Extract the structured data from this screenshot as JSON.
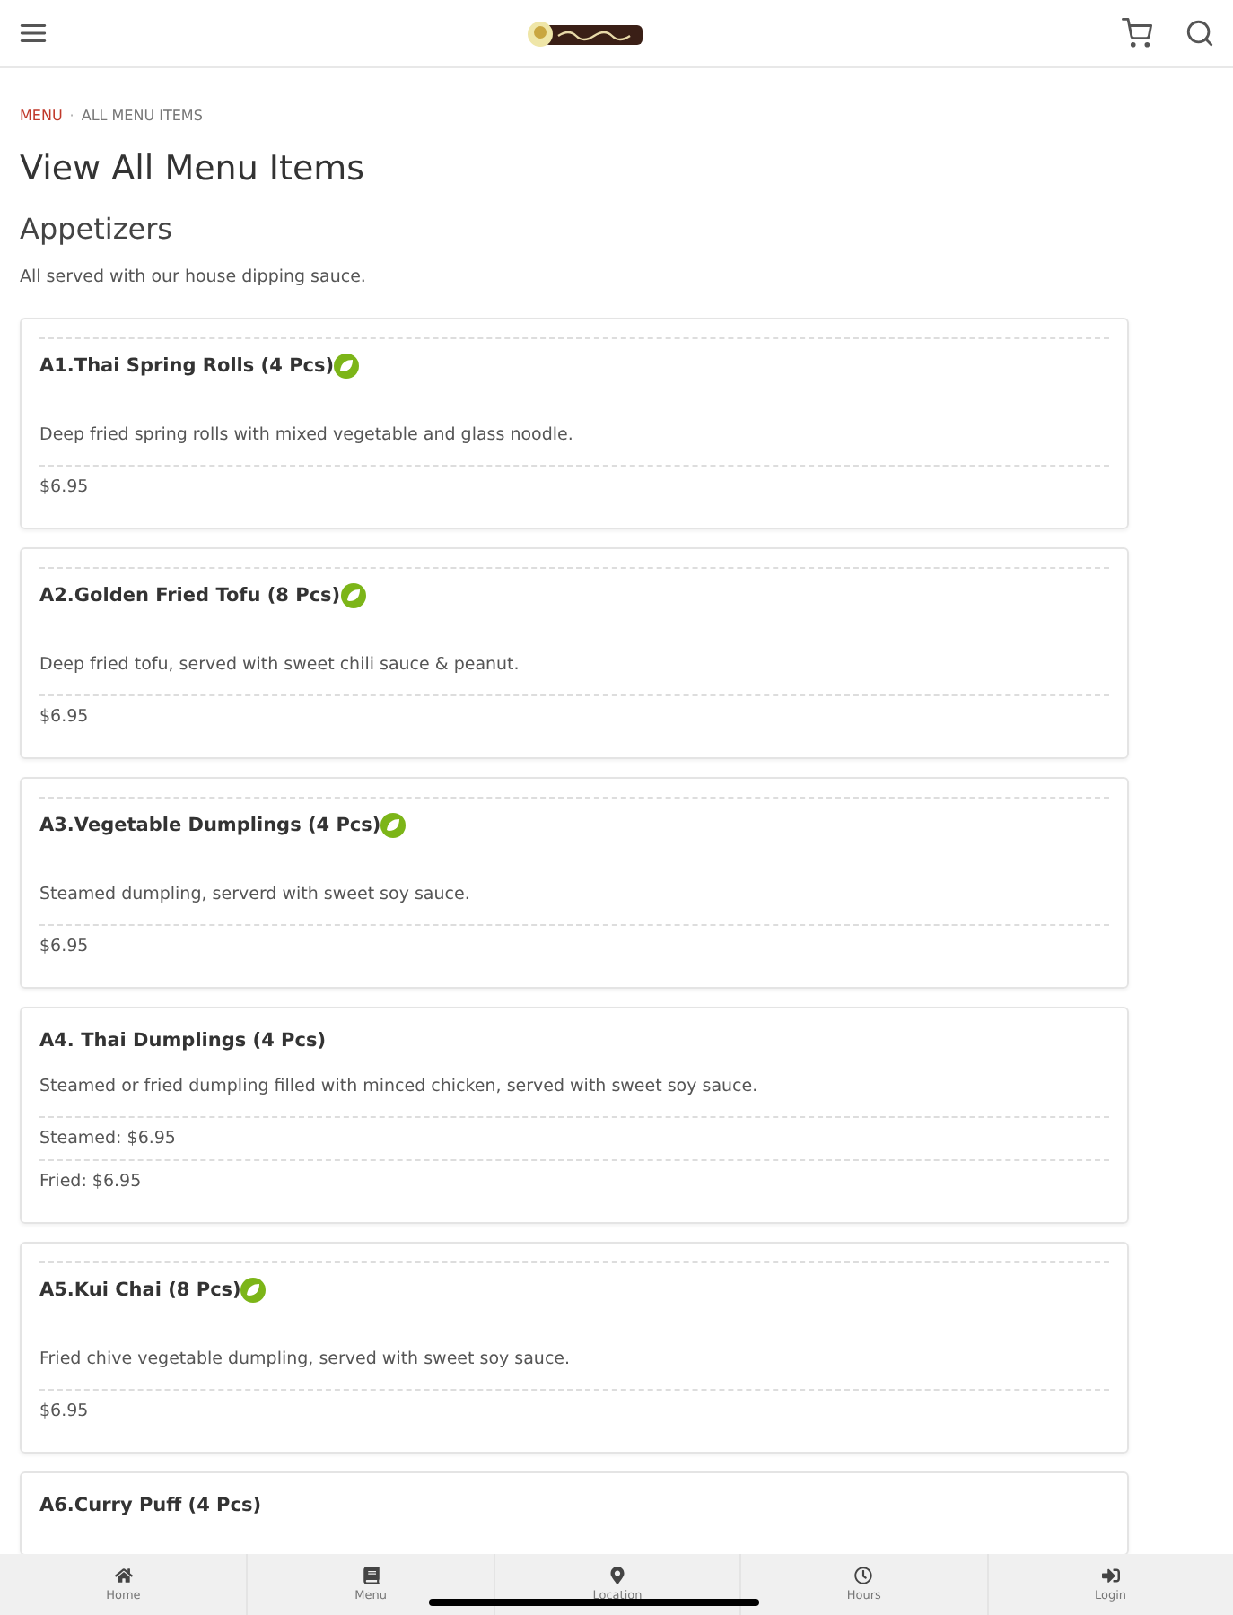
{
  "header": {
    "logo": {
      "kind": "logo"
    }
  },
  "breadcrumb": [
    {
      "label": "MENU",
      "selected": false
    },
    {
      "separator": "·",
      "label": "ALL MENU ITEMS",
      "selected": true
    }
  ],
  "page_title": "View All Menu Items",
  "category": {
    "title": "Appetizers",
    "note": "All served with our house dipping sauce."
  },
  "items": [
    {
      "name": "A1.Thai Spring Rolls (4 Pcs)",
      "vegetarian": true,
      "description": "Deep fried spring rolls with mixed vegetable and glass noodle.",
      "prices": [
        "$6.95"
      ]
    },
    {
      "name": "A2.Golden Fried Tofu (8 Pcs)",
      "vegetarian": true,
      "description": "Deep fried tofu, served with sweet chili sauce & peanut.",
      "prices": [
        "$6.95"
      ]
    },
    {
      "name": "A3.Vegetable Dumplings (4 Pcs)",
      "vegetarian": true,
      "description": "Steamed dumpling, serverd with sweet soy sauce.",
      "prices": [
        "$6.95"
      ]
    },
    {
      "name": "A4. Thai Dumplings (4 Pcs)",
      "vegetarian": false,
      "description": "Steamed or fried dumpling filled with minced chicken, served with sweet soy sauce.",
      "prices": [
        "Steamed: $6.95",
        "Fried: $6.95"
      ]
    },
    {
      "name": "A5.Kui Chai (8 Pcs)",
      "vegetarian": true,
      "description": "Fried chive vegetable dumpling, served with sweet soy sauce.",
      "prices": [
        "$6.95"
      ]
    },
    {
      "name": "A6.Curry Puff (4 Pcs)",
      "vegetarian": false
    }
  ],
  "bottom_nav": [
    {
      "label": "Home"
    },
    {
      "label": "Menu"
    },
    {
      "label": "Location"
    },
    {
      "label": "Hours"
    },
    {
      "label": "Login"
    }
  ]
}
